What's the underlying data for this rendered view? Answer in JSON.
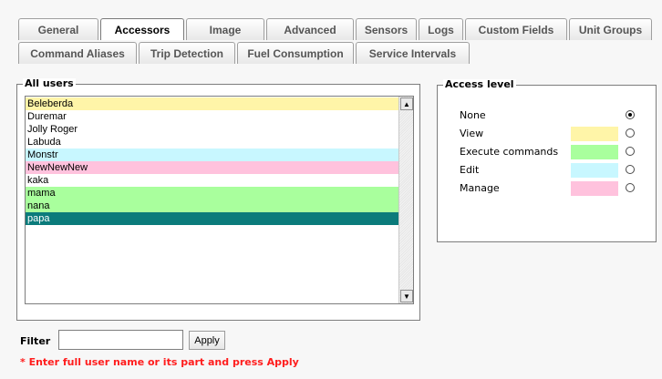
{
  "tabs": {
    "row1": [
      {
        "label": "General",
        "active": false
      },
      {
        "label": "Accessors",
        "active": true
      },
      {
        "label": "Image",
        "active": false
      },
      {
        "label": "Advanced",
        "active": false
      },
      {
        "label": "Sensors",
        "active": false
      },
      {
        "label": "Logs",
        "active": false
      },
      {
        "label": "Custom Fields",
        "active": false
      },
      {
        "label": "Unit Groups",
        "active": false
      }
    ],
    "row2": [
      {
        "label": "Command Aliases"
      },
      {
        "label": "Trip Detection"
      },
      {
        "label": "Fuel Consumption"
      },
      {
        "label": "Service Intervals"
      }
    ]
  },
  "all_users": {
    "legend": "All users",
    "items": [
      {
        "label": "Beleberda",
        "access": "View"
      },
      {
        "label": "Duremar",
        "access": "None"
      },
      {
        "label": "Jolly Roger",
        "access": "None"
      },
      {
        "label": "Labuda",
        "access": "None"
      },
      {
        "label": "Monstr",
        "access": "Edit"
      },
      {
        "label": "NewNewNew",
        "access": "Manage"
      },
      {
        "label": "kaka",
        "access": "None"
      },
      {
        "label": "mama",
        "access": "Execute commands"
      },
      {
        "label": "nana",
        "access": "Execute commands"
      },
      {
        "label": "papa",
        "access": "selected"
      }
    ]
  },
  "access_level": {
    "legend": "Access level",
    "options": [
      {
        "label": "None",
        "color": "",
        "selected": true
      },
      {
        "label": "View",
        "color": "#fff5a8",
        "selected": false
      },
      {
        "label": "Execute commands",
        "color": "#a9ff9d",
        "selected": false
      },
      {
        "label": "Edit",
        "color": "#c8f7ff",
        "selected": false
      },
      {
        "label": "Manage",
        "color": "#ffc2dd",
        "selected": false
      }
    ]
  },
  "filter": {
    "label": "Filter",
    "value": "",
    "apply_label": "Apply",
    "hint": "* Enter full user name or its part and press Apply"
  },
  "colors": {
    "selected_row": "#0b7b7b",
    "view": "#fff5a8",
    "execute_commands": "#a9ff9d",
    "edit": "#c8f7ff",
    "manage": "#ffc2dd"
  }
}
